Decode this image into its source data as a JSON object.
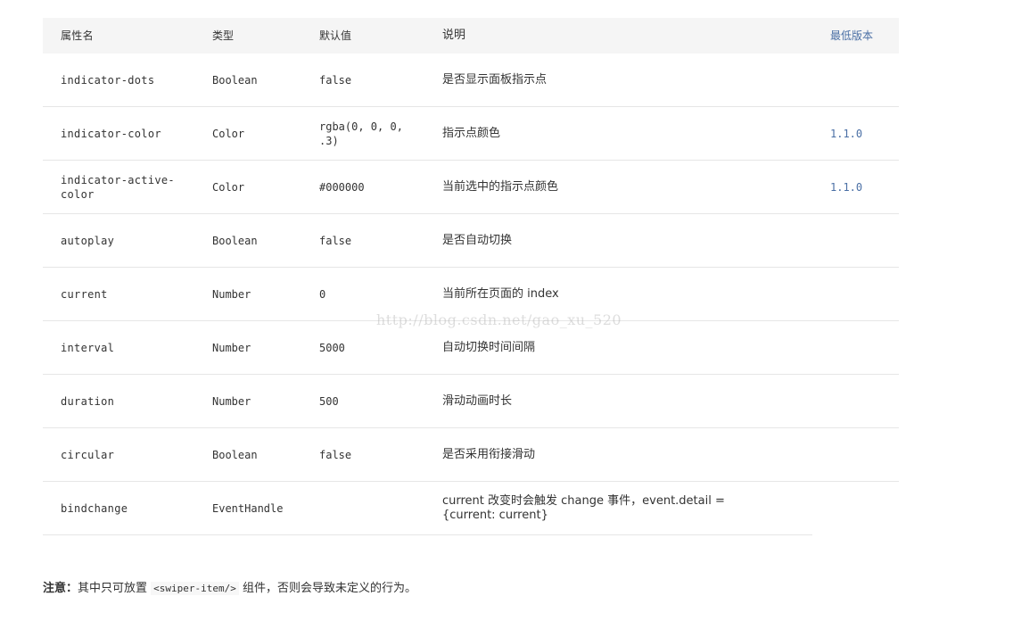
{
  "table": {
    "headers": [
      "属性名",
      "类型",
      "默认值",
      "说明",
      "最低版本"
    ],
    "rows": [
      {
        "name": "indicator-dots",
        "type": "Boolean",
        "default": "false",
        "desc": "是否显示面板指示点",
        "version": ""
      },
      {
        "name": "indicator-color",
        "type": "Color",
        "default": "rgba(0, 0, 0, .3)",
        "desc": "指示点颜色",
        "version": "1.1.0"
      },
      {
        "name": "indicator-active-color",
        "type": "Color",
        "default": "#000000",
        "desc": "当前选中的指示点颜色",
        "version": "1.1.0"
      },
      {
        "name": "autoplay",
        "type": "Boolean",
        "default": "false",
        "desc": "是否自动切换",
        "version": ""
      },
      {
        "name": "current",
        "type": "Number",
        "default": "0",
        "desc": "当前所在页面的 index",
        "version": ""
      },
      {
        "name": "interval",
        "type": "Number",
        "default": "5000",
        "desc": "自动切换时间间隔",
        "version": ""
      },
      {
        "name": "duration",
        "type": "Number",
        "default": "500",
        "desc": "滑动动画时长",
        "version": ""
      },
      {
        "name": "circular",
        "type": "Boolean",
        "default": "false",
        "desc": "是否采用衔接滑动",
        "version": ""
      },
      {
        "name": "bindchange",
        "type": "EventHandle",
        "default": "",
        "desc": "current 改变时会触发 change 事件，event.detail = {current: current}",
        "version": ""
      }
    ]
  },
  "note": {
    "label": "注意：",
    "text_before": "其中只可放置 ",
    "code": "<swiper-item/>",
    "text_after": " 组件，否则会导致未定义的行为。"
  },
  "watermark": "http://blog.csdn.net/gao_xu_520"
}
